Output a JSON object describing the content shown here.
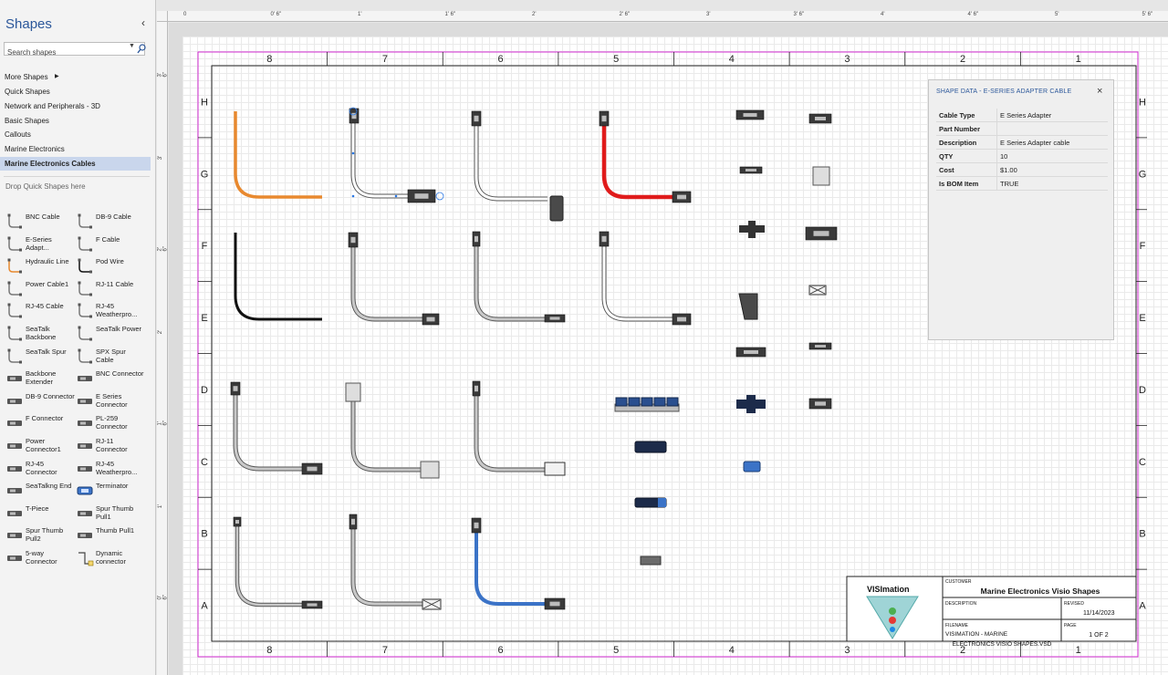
{
  "pane": {
    "title": "Shapes",
    "collapse_glyph": "‹",
    "search_placeholder": "Search shapes",
    "more_shapes": "More Shapes",
    "stencils": [
      "Quick Shapes",
      "Network and Peripherals - 3D",
      "Basic Shapes",
      "Callouts",
      "Marine Electronics",
      "Marine Electronics Cables"
    ],
    "active_stencil": "Marine Electronics Cables",
    "drop_hint": "Drop Quick Shapes here",
    "masters": [
      "BNC Cable",
      "DB-9 Cable",
      "E-Series Adapt...",
      "F Cable",
      "Hydraulic Line",
      "Pod Wire",
      "Power Cable1",
      "RJ-11 Cable",
      "RJ-45 Cable",
      "RJ-45 Weatherpro...",
      "SeaTalk Backbone",
      "SeaTalk Power",
      "SeaTalk Spur",
      "SPX Spur Cable",
      "Backbone Extender",
      "BNC Connector",
      "DB-9 Connector",
      "E Series Connector",
      "F Connector",
      "PL-259 Connector",
      "Power Connector1",
      "RJ-11 Connector",
      "RJ-45 Connector",
      "RJ-45 Weatherpro...",
      "SeaTalkng End",
      "Terminator",
      "T-Piece",
      "Spur Thumb Pull1",
      "Spur Thumb Pull2",
      "Thumb Pull1",
      "5-way Connector",
      "Dynamic connector"
    ]
  },
  "ruler": {
    "top": [
      "0",
      "0' 6\"",
      "1'",
      "1' 6\"",
      "2'",
      "2' 6\"",
      "3'",
      "3' 6\"",
      "4'",
      "4' 6\"",
      "5'",
      "5' 6\""
    ],
    "left": [
      "3' 6\"",
      "3'",
      "2' 6\"",
      "2'",
      "1' 6\"",
      "1'",
      "0' 6\""
    ]
  },
  "border": {
    "columns": [
      "8",
      "7",
      "6",
      "5",
      "4",
      "3",
      "2",
      "1"
    ],
    "rows": [
      "H",
      "G",
      "F",
      "E",
      "D",
      "C",
      "B",
      "A"
    ]
  },
  "shape_data": {
    "title": "SHAPE DATA - E-SERIES ADAPTER CABLE",
    "close_glyph": "×",
    "rows": [
      {
        "label": "Cable Type",
        "value": "E Series Adapter"
      },
      {
        "label": "Part Number",
        "value": ""
      },
      {
        "label": "Description",
        "value": "E Series Adapter cable"
      },
      {
        "label": "QTY",
        "value": "10"
      },
      {
        "label": "Cost",
        "value": "$1.00"
      },
      {
        "label": "Is BOM Item",
        "value": "TRUE"
      }
    ]
  },
  "title_block": {
    "logo": "VISImation",
    "customer_label": "CUSTOMER",
    "customer": "Marine Electronics Visio Shapes",
    "description_label": "DESCRIPTION",
    "revised_label": "REVISED",
    "revised": "11/14/2023",
    "filename_label": "FILENAME",
    "filename": "VISIMATION - MARINE ELECTRONICS VISIO SHAPES.VSD",
    "page_label": "PAGE",
    "page": "1 OF 2"
  },
  "colors": {
    "accent": "#2b579a",
    "frame": "#d12bd1",
    "hydraulic": "#e8892f",
    "red_cable": "#e01b1b",
    "blue_cable": "#3b73c7",
    "black_cable": "#111111"
  }
}
